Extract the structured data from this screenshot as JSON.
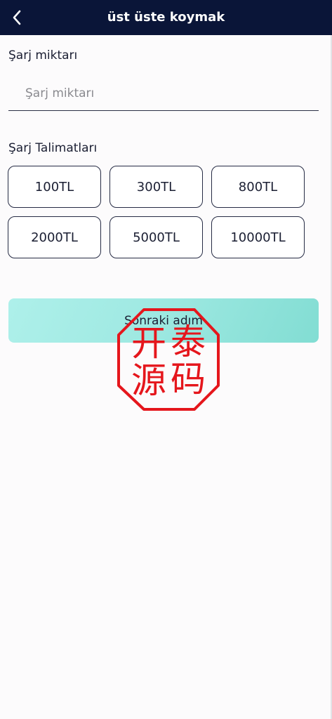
{
  "header": {
    "title": "üst üste koymak",
    "back_icon": "chevron-left-icon",
    "background": "#0a1538"
  },
  "amount": {
    "label": "Şarj miktarı",
    "placeholder": "Şarj miktarı",
    "value": ""
  },
  "instructions": {
    "label": "Şarj Talimatları",
    "options": [
      "100TL",
      "300TL",
      "800TL",
      "2000TL",
      "5000TL",
      "10000TL"
    ]
  },
  "next_button": {
    "label": "Sonraki adım",
    "gradient": [
      "#aef0ea",
      "#82ddd3"
    ]
  },
  "watermark_seal": {
    "text": [
      "开",
      "泰",
      "源",
      "码"
    ],
    "color": "#e5161c"
  }
}
